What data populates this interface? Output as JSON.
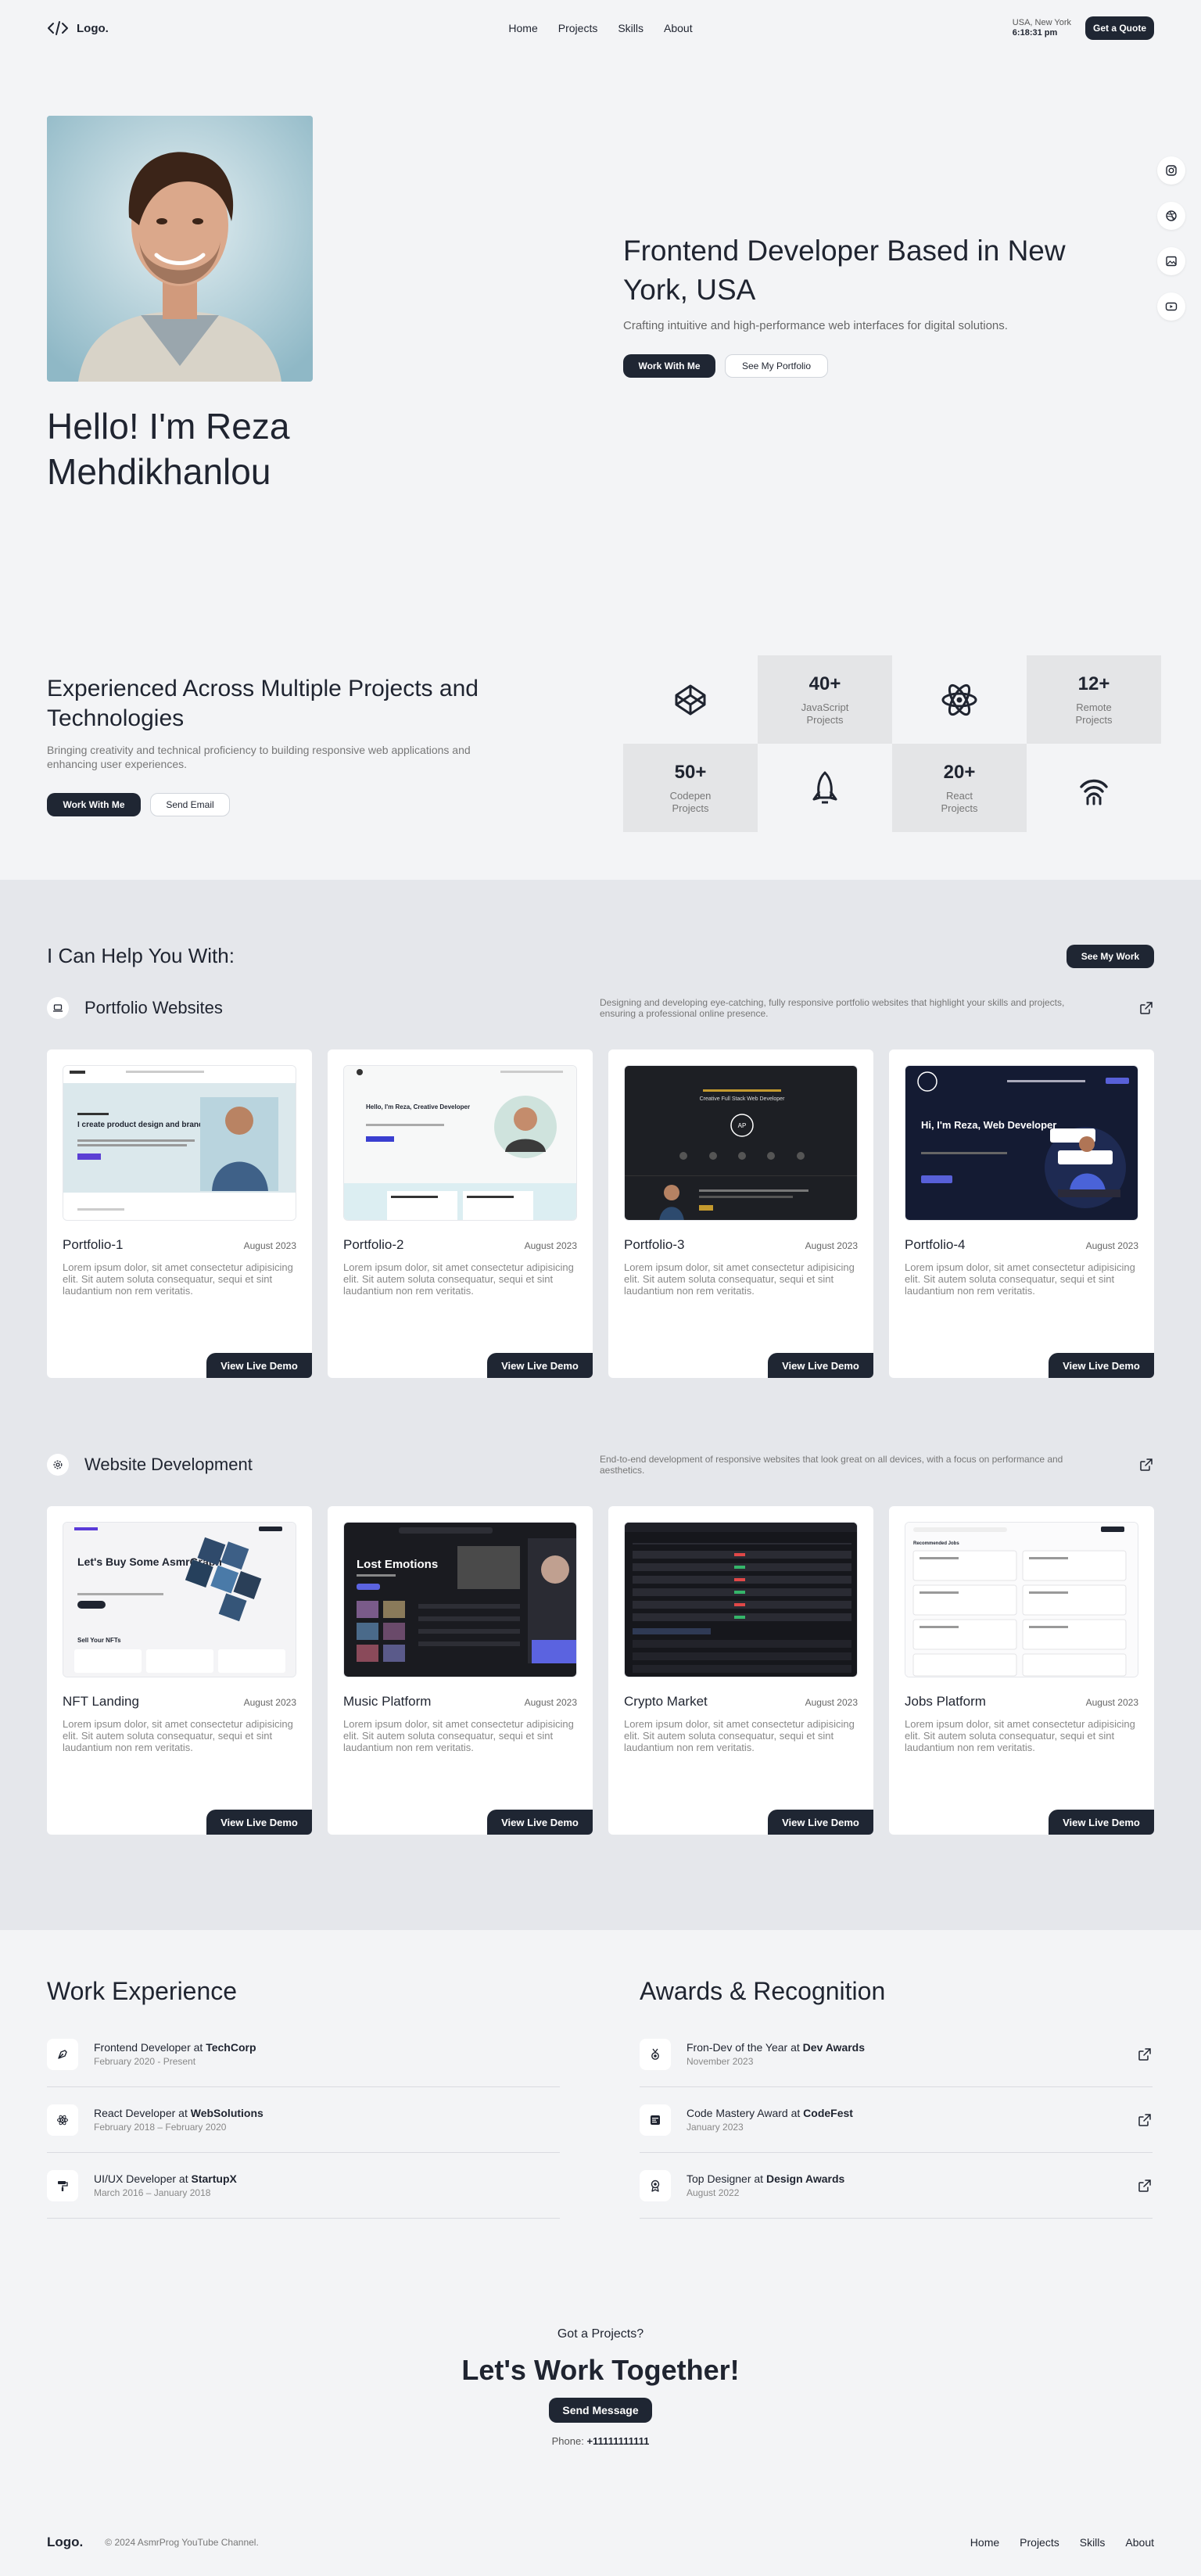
{
  "nav": {
    "logo": "Logo.",
    "links": [
      "Home",
      "Projects",
      "Skills",
      "About"
    ],
    "location": "USA, New York",
    "time": "6:18:31 pm",
    "quote_button": "Get a Quote"
  },
  "hero": {
    "hello": "Hello! I'm Reza Mehdikhanlou",
    "headline": "Frontend Developer Based in New York, USA",
    "subtitle": "Crafting intuitive and high-performance web interfaces for digital solutions.",
    "primary_button": "Work With Me",
    "secondary_button": "See My Portfolio",
    "socials": [
      "instagram-icon",
      "dribbble-icon",
      "image-icon",
      "youtube-icon"
    ]
  },
  "stats": {
    "title": "Experienced Across Multiple Projects and Technologies",
    "subtitle": "Bringing creativity and technical proficiency to building responsive web applications and enhancing user experiences.",
    "primary_button": "Work With Me",
    "secondary_button": "Send Email",
    "items": [
      {
        "icon": "codepen-icon"
      },
      {
        "num": "40+",
        "label": "JavaScript Projects"
      },
      {
        "icon": "react-icon"
      },
      {
        "num": "12+",
        "label": "Remote Projects"
      },
      {
        "num": "50+",
        "label": "Codepen Projects"
      },
      {
        "icon": "rocket-icon"
      },
      {
        "num": "20+",
        "label": "React Projects"
      },
      {
        "icon": "wifi-icon"
      }
    ]
  },
  "services": {
    "title": "I Can Help You With:",
    "button": "See My Work",
    "categories": [
      {
        "title": "Portfolio Websites",
        "description": "Designing and developing eye-catching, fully responsive portfolio websites that highlight your skills and projects, ensuring a professional online presence.",
        "cards": [
          {
            "title": "Portfolio-1",
            "date": "August 2023",
            "desc": "Lorem ipsum dolor, sit amet consectetur adipisicing elit. Sit autem soluta consequatur, sequi et sint laudantium non rem veritatis.",
            "button": "View Live Demo"
          },
          {
            "title": "Portfolio-2",
            "date": "August 2023",
            "desc": "Lorem ipsum dolor, sit amet consectetur adipisicing elit. Sit autem soluta consequatur, sequi et sint laudantium non rem veritatis.",
            "button": "View Live Demo"
          },
          {
            "title": "Portfolio-3",
            "date": "August 2023",
            "desc": "Lorem ipsum dolor, sit amet consectetur adipisicing elit. Sit autem soluta consequatur, sequi et sint laudantium non rem veritatis.",
            "button": "View Live Demo"
          },
          {
            "title": "Portfolio-4",
            "date": "August 2023",
            "desc": "Lorem ipsum dolor, sit amet consectetur adipisicing elit. Sit autem soluta consequatur, sequi et sint laudantium non rem veritatis.",
            "button": "View Live Demo"
          }
        ]
      },
      {
        "title": "Website Development",
        "description": "End-to-end development of responsive websites that look great on all devices, with a focus on performance and aesthetics.",
        "cards": [
          {
            "title": "NFT Landing",
            "date": "August 2023",
            "desc": "Lorem ipsum dolor, sit amet consectetur adipisicing elit. Sit autem soluta consequatur, sequi et sint laudantium non rem veritatis.",
            "button": "View Live Demo"
          },
          {
            "title": "Music Platform",
            "date": "August 2023",
            "desc": "Lorem ipsum dolor, sit amet consectetur adipisicing elit. Sit autem soluta consequatur, sequi et sint laudantium non rem veritatis.",
            "button": "View Live Demo"
          },
          {
            "title": "Crypto Market",
            "date": "August 2023",
            "desc": "Lorem ipsum dolor, sit amet consectetur adipisicing elit. Sit autem soluta consequatur, sequi et sint laudantium non rem veritatis.",
            "button": "View Live Demo"
          },
          {
            "title": "Jobs Platform",
            "date": "August 2023",
            "desc": "Lorem ipsum dolor, sit amet consectetur adipisicing elit. Sit autem soluta consequatur, sequi et sint laudantium non rem veritatis.",
            "button": "View Live Demo"
          }
        ]
      }
    ],
    "thumbs": {
      "p1_headline": "I create product design and brand experience",
      "p2_headline": "Hello, I'm Reza, Creative Developer",
      "p3_headline": "Creative Full Stack Web Developer",
      "p4_headline": "Hi, I'm Reza, Web Developer",
      "nft_headline": "Let's Buy Some AsmrGraph",
      "nft_sub": "Sell Your NFTs",
      "music_headline": "Lost Emotions",
      "jobs_headline": "Recommended Jobs"
    }
  },
  "experience": {
    "title": "Work Experience",
    "items": [
      {
        "role": "Frontend Developer at ",
        "org": "TechCorp",
        "when": "February 2020 - Present",
        "icon": "pen-tool-icon"
      },
      {
        "role": "React Developer at ",
        "org": "WebSolutions",
        "when": "February 2018 – February 2020",
        "icon": "react-icon"
      },
      {
        "role": "UI/UX Developer at ",
        "org": "StartupX",
        "when": "March 2016 – January 2018",
        "icon": "paint-roller-icon"
      }
    ]
  },
  "awards": {
    "title": "Awards & Recognition",
    "items": [
      {
        "role": "Fron-Dev of the Year at ",
        "org": "Dev Awards",
        "when": "November 2023",
        "icon": "medal-icon"
      },
      {
        "role": "Code Mastery Award at ",
        "org": "CodeFest",
        "when": "January 2023",
        "icon": "code-window-icon"
      },
      {
        "role": "Top Designer at ",
        "org": "Design Awards",
        "when": "August 2022",
        "icon": "award-ribbon-icon"
      }
    ]
  },
  "cta": {
    "small": "Got a Projects?",
    "big": "Let's Work Together!",
    "button": "Send Message",
    "phone_label": "Phone: ",
    "phone": "+11111111111"
  },
  "footer": {
    "logo": "Logo.",
    "copyright": "© 2024 AsmrProg YouTube Channel.",
    "links": [
      "Home",
      "Projects",
      "Skills",
      "About"
    ]
  }
}
